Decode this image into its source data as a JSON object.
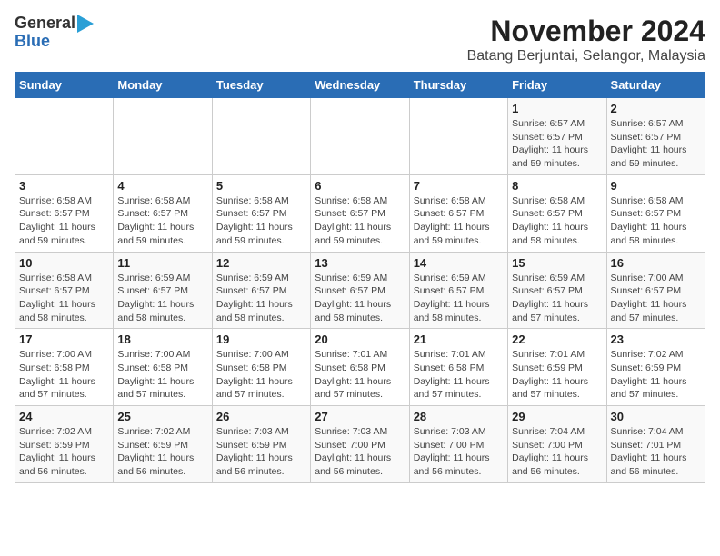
{
  "header": {
    "logo_line1": "General",
    "logo_line2": "Blue",
    "title": "November 2024",
    "subtitle": "Batang Berjuntai, Selangor, Malaysia"
  },
  "calendar": {
    "days_of_week": [
      "Sunday",
      "Monday",
      "Tuesday",
      "Wednesday",
      "Thursday",
      "Friday",
      "Saturday"
    ],
    "weeks": [
      [
        {
          "day": "",
          "info": ""
        },
        {
          "day": "",
          "info": ""
        },
        {
          "day": "",
          "info": ""
        },
        {
          "day": "",
          "info": ""
        },
        {
          "day": "",
          "info": ""
        },
        {
          "day": "1",
          "info": "Sunrise: 6:57 AM\nSunset: 6:57 PM\nDaylight: 11 hours\nand 59 minutes."
        },
        {
          "day": "2",
          "info": "Sunrise: 6:57 AM\nSunset: 6:57 PM\nDaylight: 11 hours\nand 59 minutes."
        }
      ],
      [
        {
          "day": "3",
          "info": "Sunrise: 6:58 AM\nSunset: 6:57 PM\nDaylight: 11 hours\nand 59 minutes."
        },
        {
          "day": "4",
          "info": "Sunrise: 6:58 AM\nSunset: 6:57 PM\nDaylight: 11 hours\nand 59 minutes."
        },
        {
          "day": "5",
          "info": "Sunrise: 6:58 AM\nSunset: 6:57 PM\nDaylight: 11 hours\nand 59 minutes."
        },
        {
          "day": "6",
          "info": "Sunrise: 6:58 AM\nSunset: 6:57 PM\nDaylight: 11 hours\nand 59 minutes."
        },
        {
          "day": "7",
          "info": "Sunrise: 6:58 AM\nSunset: 6:57 PM\nDaylight: 11 hours\nand 59 minutes."
        },
        {
          "day": "8",
          "info": "Sunrise: 6:58 AM\nSunset: 6:57 PM\nDaylight: 11 hours\nand 58 minutes."
        },
        {
          "day": "9",
          "info": "Sunrise: 6:58 AM\nSunset: 6:57 PM\nDaylight: 11 hours\nand 58 minutes."
        }
      ],
      [
        {
          "day": "10",
          "info": "Sunrise: 6:58 AM\nSunset: 6:57 PM\nDaylight: 11 hours\nand 58 minutes."
        },
        {
          "day": "11",
          "info": "Sunrise: 6:59 AM\nSunset: 6:57 PM\nDaylight: 11 hours\nand 58 minutes."
        },
        {
          "day": "12",
          "info": "Sunrise: 6:59 AM\nSunset: 6:57 PM\nDaylight: 11 hours\nand 58 minutes."
        },
        {
          "day": "13",
          "info": "Sunrise: 6:59 AM\nSunset: 6:57 PM\nDaylight: 11 hours\nand 58 minutes."
        },
        {
          "day": "14",
          "info": "Sunrise: 6:59 AM\nSunset: 6:57 PM\nDaylight: 11 hours\nand 58 minutes."
        },
        {
          "day": "15",
          "info": "Sunrise: 6:59 AM\nSunset: 6:57 PM\nDaylight: 11 hours\nand 57 minutes."
        },
        {
          "day": "16",
          "info": "Sunrise: 7:00 AM\nSunset: 6:57 PM\nDaylight: 11 hours\nand 57 minutes."
        }
      ],
      [
        {
          "day": "17",
          "info": "Sunrise: 7:00 AM\nSunset: 6:58 PM\nDaylight: 11 hours\nand 57 minutes."
        },
        {
          "day": "18",
          "info": "Sunrise: 7:00 AM\nSunset: 6:58 PM\nDaylight: 11 hours\nand 57 minutes."
        },
        {
          "day": "19",
          "info": "Sunrise: 7:00 AM\nSunset: 6:58 PM\nDaylight: 11 hours\nand 57 minutes."
        },
        {
          "day": "20",
          "info": "Sunrise: 7:01 AM\nSunset: 6:58 PM\nDaylight: 11 hours\nand 57 minutes."
        },
        {
          "day": "21",
          "info": "Sunrise: 7:01 AM\nSunset: 6:58 PM\nDaylight: 11 hours\nand 57 minutes."
        },
        {
          "day": "22",
          "info": "Sunrise: 7:01 AM\nSunset: 6:59 PM\nDaylight: 11 hours\nand 57 minutes."
        },
        {
          "day": "23",
          "info": "Sunrise: 7:02 AM\nSunset: 6:59 PM\nDaylight: 11 hours\nand 57 minutes."
        }
      ],
      [
        {
          "day": "24",
          "info": "Sunrise: 7:02 AM\nSunset: 6:59 PM\nDaylight: 11 hours\nand 56 minutes."
        },
        {
          "day": "25",
          "info": "Sunrise: 7:02 AM\nSunset: 6:59 PM\nDaylight: 11 hours\nand 56 minutes."
        },
        {
          "day": "26",
          "info": "Sunrise: 7:03 AM\nSunset: 6:59 PM\nDaylight: 11 hours\nand 56 minutes."
        },
        {
          "day": "27",
          "info": "Sunrise: 7:03 AM\nSunset: 7:00 PM\nDaylight: 11 hours\nand 56 minutes."
        },
        {
          "day": "28",
          "info": "Sunrise: 7:03 AM\nSunset: 7:00 PM\nDaylight: 11 hours\nand 56 minutes."
        },
        {
          "day": "29",
          "info": "Sunrise: 7:04 AM\nSunset: 7:00 PM\nDaylight: 11 hours\nand 56 minutes."
        },
        {
          "day": "30",
          "info": "Sunrise: 7:04 AM\nSunset: 7:01 PM\nDaylight: 11 hours\nand 56 minutes."
        }
      ]
    ]
  }
}
